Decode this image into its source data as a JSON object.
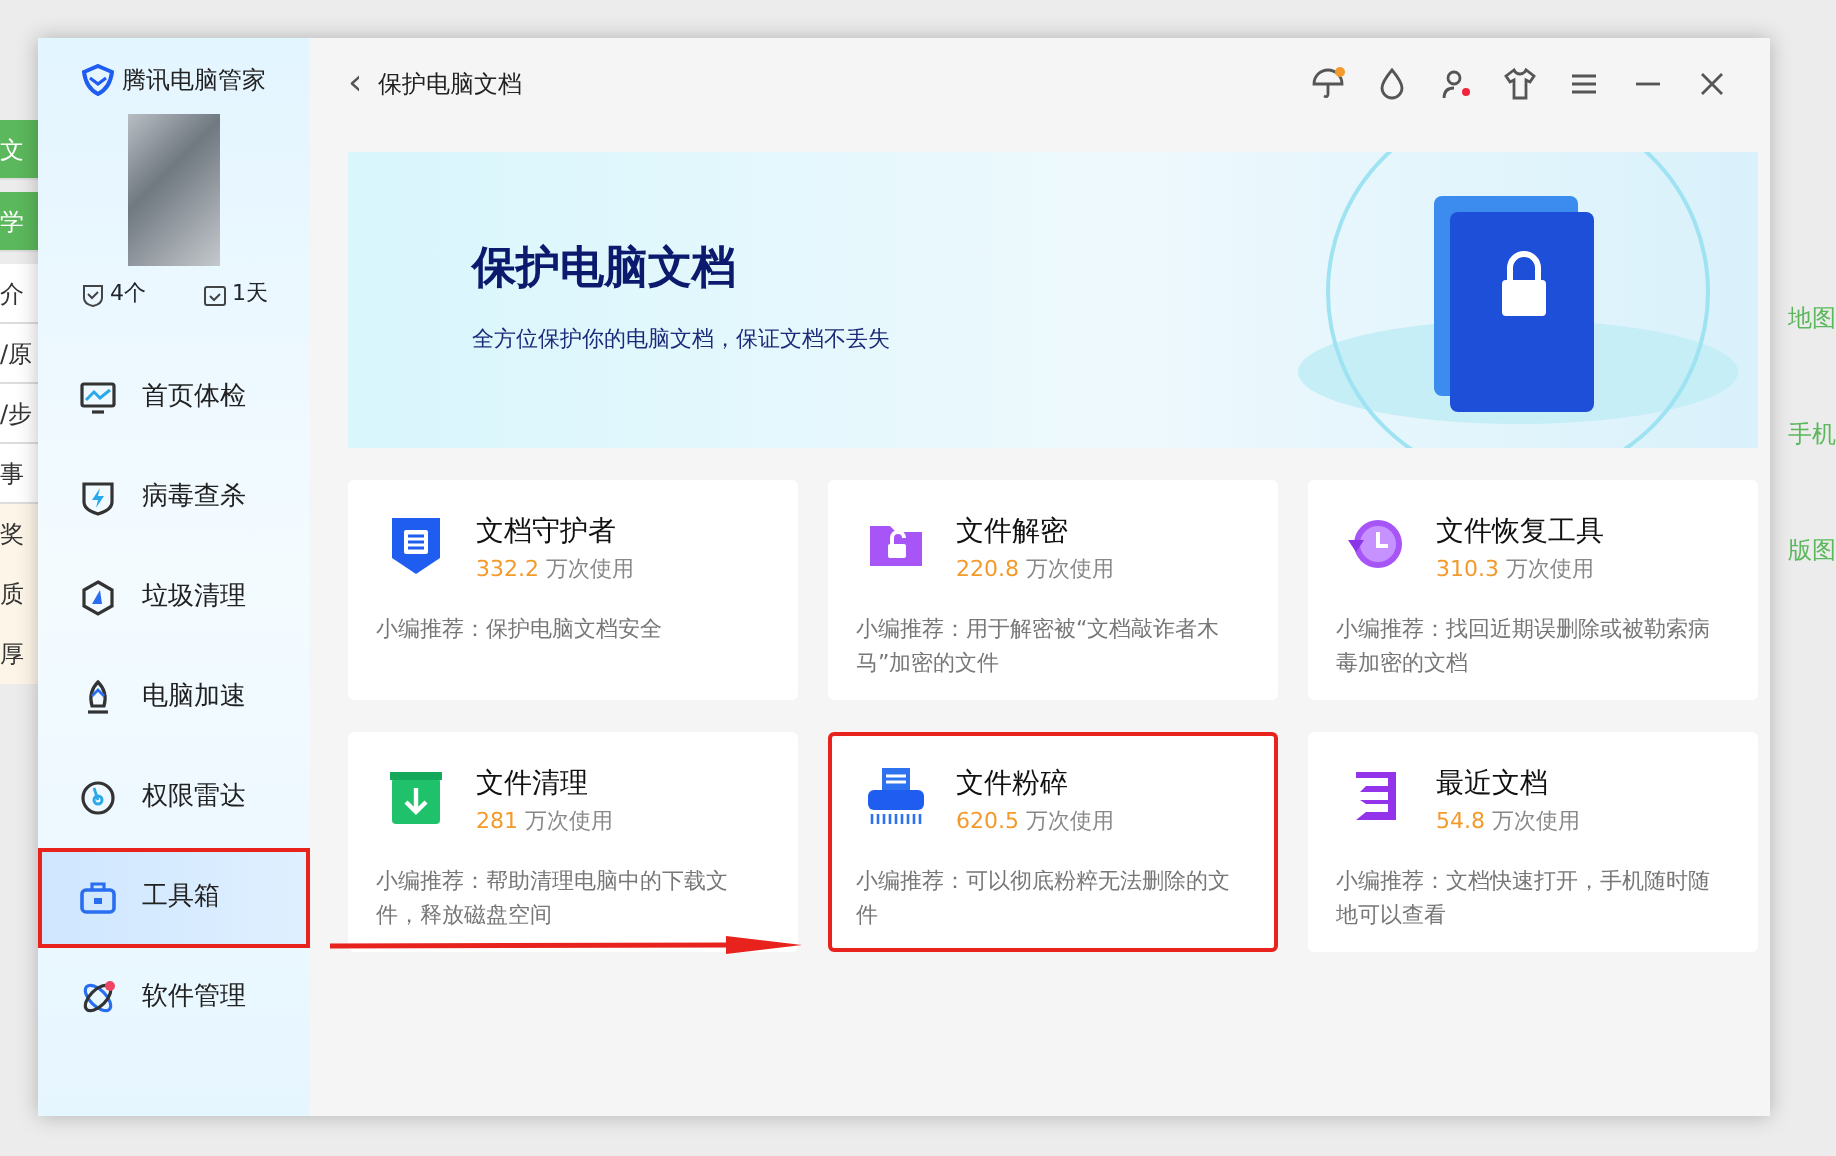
{
  "background_page": {
    "left_fragments": [
      "文",
      "学",
      "介",
      "/原",
      "/步",
      "事",
      "奖",
      "质",
      "厚"
    ],
    "right_fragments": [
      "地图",
      "手机",
      "版图"
    ]
  },
  "sidebar": {
    "brand": "腾讯电脑管家",
    "stats": [
      {
        "kind": "shield",
        "text": "4个"
      },
      {
        "kind": "calendar",
        "text": "1天"
      }
    ],
    "items": [
      {
        "kind": "monitor",
        "label": "首页体检",
        "selected": false,
        "highlighted": false
      },
      {
        "kind": "virus",
        "label": "病毒查杀",
        "selected": false,
        "highlighted": false
      },
      {
        "kind": "clean",
        "label": "垃圾清理",
        "selected": false,
        "highlighted": false
      },
      {
        "kind": "rocket",
        "label": "电脑加速",
        "selected": false,
        "highlighted": false
      },
      {
        "kind": "radar",
        "label": "权限雷达",
        "selected": false,
        "highlighted": false
      },
      {
        "kind": "toolbox",
        "label": "工具箱",
        "selected": true,
        "highlighted": true
      },
      {
        "kind": "apps",
        "label": "软件管理",
        "selected": false,
        "highlighted": false
      }
    ]
  },
  "header": {
    "back": "‹",
    "title": "保护电脑文档"
  },
  "banner": {
    "title": "保护电脑文档",
    "subtitle": "全方位保护你的电脑文档，保证文档不丢失"
  },
  "tools": [
    {
      "kind": "guard",
      "name": "文档守护者",
      "count": "332.2",
      "unit": "万次使用",
      "desc": "小编推荐：保护电脑文档安全",
      "highlighted": false
    },
    {
      "kind": "decrypt",
      "name": "文件解密",
      "count": "220.8",
      "unit": "万次使用",
      "desc": "小编推荐：用于解密被“文档敲诈者木马”加密的文件",
      "highlighted": false
    },
    {
      "kind": "recover",
      "name": "文件恢复工具",
      "count": "310.3",
      "unit": "万次使用",
      "desc": "小编推荐：找回近期误删除或被勒索病毒加密的文档",
      "highlighted": false
    },
    {
      "kind": "trash",
      "name": "文件清理",
      "count": "281",
      "unit": "万次使用",
      "desc": "小编推荐：帮助清理电脑中的下载文件，释放磁盘空间",
      "highlighted": false
    },
    {
      "kind": "shredder",
      "name": "文件粉碎",
      "count": "620.5",
      "unit": "万次使用",
      "desc": "小编推荐：可以彻底粉粹无法删除的文件",
      "highlighted": true
    },
    {
      "kind": "recent",
      "name": "最近文档",
      "count": "54.8",
      "unit": "万次使用",
      "desc": "小编推荐：文档快速打开，手机随时随地可以查看",
      "highlighted": false
    }
  ]
}
